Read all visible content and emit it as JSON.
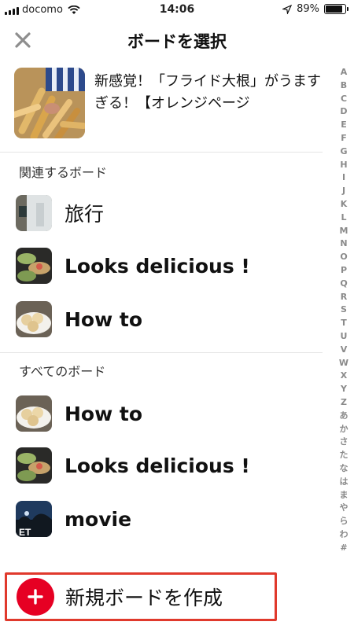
{
  "status_bar": {
    "carrier": "docomo",
    "time": "14:06",
    "battery_percent": "89%",
    "battery_level": 0.89
  },
  "header": {
    "title": "ボードを選択",
    "close_icon": "close-icon"
  },
  "pin": {
    "title": "新感覚！「フライド大根」がうますぎる！【オレンジページ"
  },
  "sections": {
    "related_label": "関連するボード",
    "all_label": "すべてのボード"
  },
  "related_boards": [
    {
      "name": "旅行"
    },
    {
      "name": "Looks delicious !"
    },
    {
      "name": "How to"
    }
  ],
  "all_boards": [
    {
      "name": "How to"
    },
    {
      "name": "Looks delicious !"
    },
    {
      "name": "movie"
    }
  ],
  "index_letters": [
    "A",
    "B",
    "C",
    "D",
    "E",
    "F",
    "G",
    "H",
    "I",
    "J",
    "K",
    "L",
    "M",
    "N",
    "O",
    "P",
    "Q",
    "R",
    "S",
    "T",
    "U",
    "V",
    "W",
    "X",
    "Y",
    "Z",
    "あ",
    "か",
    "さ",
    "た",
    "な",
    "は",
    "ま",
    "や",
    "ら",
    "わ",
    "#"
  ],
  "create": {
    "label": "新規ボードを作成",
    "icon": "plus-icon"
  },
  "colors": {
    "accent": "#e60023",
    "highlight_border": "#e0392c"
  }
}
